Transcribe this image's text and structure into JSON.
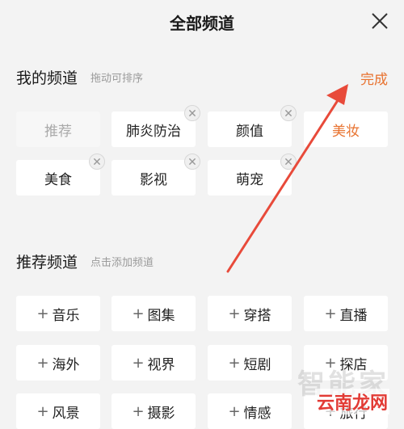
{
  "header": {
    "title": "全部频道",
    "close_icon": "close-icon"
  },
  "my_channels": {
    "title": "我的频道",
    "hint": "拖动可排序",
    "done_label": "完成",
    "items": [
      {
        "label": "推荐",
        "removable": false,
        "state": "fixed"
      },
      {
        "label": "肺炎防治",
        "removable": true,
        "state": "normal"
      },
      {
        "label": "颜值",
        "removable": true,
        "state": "normal"
      },
      {
        "label": "美妆",
        "removable": false,
        "state": "selected"
      },
      {
        "label": "美食",
        "removable": true,
        "state": "normal"
      },
      {
        "label": "影视",
        "removable": true,
        "state": "normal"
      },
      {
        "label": "萌宠",
        "removable": true,
        "state": "normal"
      }
    ]
  },
  "recommended_channels": {
    "title": "推荐频道",
    "hint": "点击添加频道",
    "items": [
      {
        "label": "音乐"
      },
      {
        "label": "图集"
      },
      {
        "label": "穿搭"
      },
      {
        "label": "直播"
      },
      {
        "label": "海外"
      },
      {
        "label": "视界"
      },
      {
        "label": "短剧"
      },
      {
        "label": "探店"
      },
      {
        "label": "风景"
      },
      {
        "label": "摄影"
      },
      {
        "label": "情感"
      },
      {
        "label": "旅行"
      }
    ]
  },
  "watermark": {
    "logo_text": "智能家",
    "site_text": "云南龙网"
  },
  "colors": {
    "accent": "#e8722f",
    "arrow": "#e84a3a",
    "background": "#f3f3f3"
  }
}
